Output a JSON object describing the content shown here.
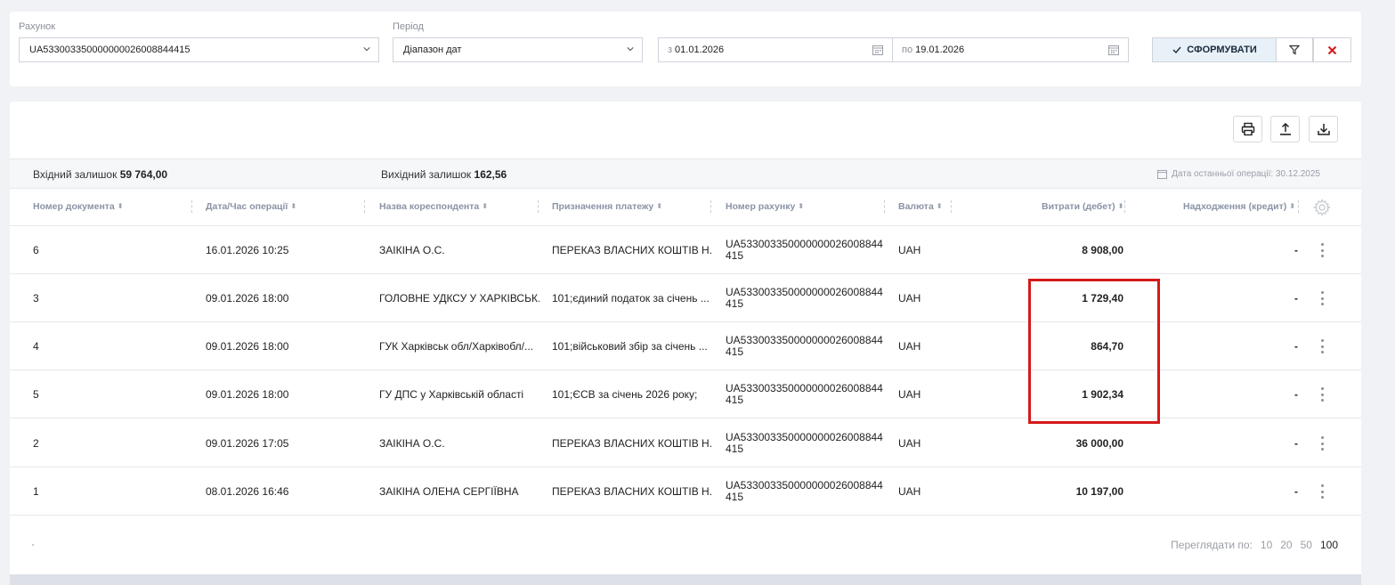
{
  "filters": {
    "account_label": "Рахунок",
    "account_value": "UA533003350000000026008844415",
    "period_label": "Період",
    "period_value": "Діапазон дат",
    "from_prefix": "з",
    "from_value": "01.01.2026",
    "to_prefix": "по",
    "to_value": "19.01.2026",
    "generate_label": "СФОРМУВАТИ"
  },
  "summary": {
    "opening_label": "Вхідний залишок",
    "opening_value": "59 764,00",
    "closing_label": "Вихідний залишок",
    "closing_value": "162,56",
    "last_op_label": "Дата останньої операції: 30.12.2025"
  },
  "columns": [
    "Номер документа",
    "Дата/Час операції",
    "Назва кореспондента",
    "Призначення платежу",
    "Номер рахунку",
    "Валюта",
    "Витрати (дебет)",
    "Надходження (кредит)"
  ],
  "rows": [
    {
      "doc": "6",
      "date": "16.01.2026 10:25",
      "counterparty": "ЗАІКІНА О.С.",
      "purpose": "ПЕРЕКАЗ ВЛАСНИХ КОШТІВ Н...",
      "account": "UA533003350000000026008844415",
      "currency": "UAH",
      "debit": "8 908,00",
      "credit": "-"
    },
    {
      "doc": "3",
      "date": "09.01.2026 18:00",
      "counterparty": "ГОЛОВНЕ УДКСУ У ХАРКІВСЬК...",
      "purpose": "101;єдиний податок за січень ...",
      "account": "UA533003350000000026008844415",
      "currency": "UAH",
      "debit": "1 729,40",
      "credit": "-"
    },
    {
      "doc": "4",
      "date": "09.01.2026 18:00",
      "counterparty": "ГУК Харківськ обл/Харківобл/...",
      "purpose": "101;військовий збір за січень ...",
      "account": "UA533003350000000026008844415",
      "currency": "UAH",
      "debit": "864,70",
      "credit": "-"
    },
    {
      "doc": "5",
      "date": "09.01.2026 18:00",
      "counterparty": "ГУ ДПС у Харківській області",
      "purpose": "101;ЄСВ за січень 2026 року;",
      "account": "UA533003350000000026008844415",
      "currency": "UAH",
      "debit": "1 902,34",
      "credit": "-"
    },
    {
      "doc": "2",
      "date": "09.01.2026 17:05",
      "counterparty": "ЗАІКІНА О.С.",
      "purpose": "ПЕРЕКАЗ ВЛАСНИХ КОШТІВ Н...",
      "account": "UA533003350000000026008844415",
      "currency": "UAH",
      "debit": "36 000,00",
      "credit": "-"
    },
    {
      "doc": "1",
      "date": "08.01.2026 16:46",
      "counterparty": "ЗАІКІНА ОЛЕНА СЕРГІЇВНА",
      "purpose": "ПЕРЕКАЗ ВЛАСНИХ КОШТІВ Н...",
      "account": "UA533003350000000026008844415",
      "currency": "UAH",
      "debit": "10 197,00",
      "credit": "-"
    }
  ],
  "pagination": {
    "label": "Переглядати по:",
    "options": [
      "10",
      "20",
      "50",
      "100"
    ],
    "active": "100"
  },
  "colors": {
    "highlight": "#d51a1a",
    "close_icon": "#d51a1a"
  }
}
